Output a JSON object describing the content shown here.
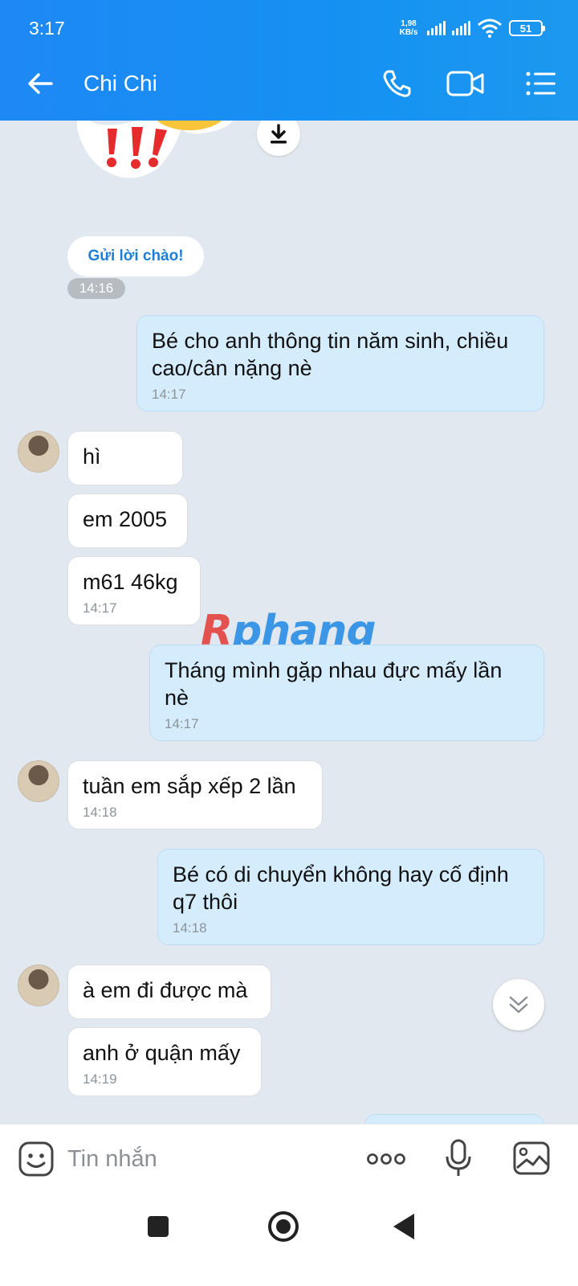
{
  "status_bar": {
    "time": "3:17",
    "net_speed_value": "1,98",
    "net_speed_unit": "KB/s",
    "battery": "51"
  },
  "header": {
    "title": "Chi Chi",
    "icons": [
      "back-arrow-icon",
      "phone-icon",
      "video-camera-icon",
      "menu-list-icon"
    ]
  },
  "greeting": {
    "button_label": "Gửi lời chào!",
    "time": "14:16"
  },
  "messages": [
    {
      "side": "out",
      "text": "Bé cho anh thông tin năm sinh, chiều cao/cân nặng nè",
      "time": "14:17"
    },
    {
      "side": "in",
      "text": "hì",
      "time": ""
    },
    {
      "side": "in",
      "text": "em 2005",
      "time": ""
    },
    {
      "side": "in",
      "text": "m61 46kg",
      "time": "14:17"
    },
    {
      "side": "out",
      "text": "Tháng mình gặp nhau đực mấy lần nè",
      "time": "14:17"
    },
    {
      "side": "in",
      "text": "tuần em sắp xếp 2 lần",
      "time": "14:18"
    },
    {
      "side": "out",
      "text": "Bé có di chuyển không hay cố định q7 thôi",
      "time": "14:18"
    },
    {
      "side": "in",
      "text": "à em đi được mà",
      "time": ""
    },
    {
      "side": "in",
      "text": "anh ở quận mấy",
      "time": "14:19"
    }
  ],
  "watermark": {
    "first": "R",
    "rest": "phang"
  },
  "composer": {
    "placeholder": "Tin nhắn"
  },
  "colors": {
    "header": "#1e88f5",
    "outgoing_bubble": "#d5ecfd",
    "incoming_bubble": "#ffffff",
    "background": "#e2e8ef",
    "greeting_text": "#1f7ed8"
  }
}
